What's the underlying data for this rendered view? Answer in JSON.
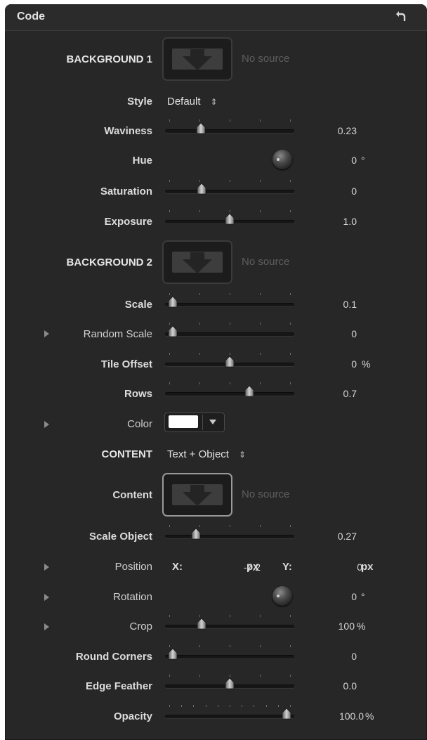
{
  "panel": {
    "title": "Code"
  },
  "background1": {
    "section_label": "BACKGROUND 1",
    "well_text": "No source"
  },
  "style": {
    "label": "Style",
    "value": "Default"
  },
  "waviness": {
    "label": "Waviness",
    "value": "0.23",
    "fraction": 0.26
  },
  "hue": {
    "label": "Hue",
    "value": "0",
    "unit": "°"
  },
  "saturation": {
    "label": "Saturation",
    "value": "0",
    "fraction": 0.27
  },
  "exposure": {
    "label": "Exposure",
    "value": "1.0",
    "fraction": 0.5
  },
  "background2": {
    "section_label": "BACKGROUND 2",
    "well_text": "No source"
  },
  "scale": {
    "label": "Scale",
    "value": "0.1",
    "fraction": 0.03
  },
  "random_scale": {
    "label": "Random Scale",
    "value": "0",
    "fraction": 0.03
  },
  "tile_offset": {
    "label": "Tile Offset",
    "value": "0",
    "unit": "%",
    "fraction": 0.5
  },
  "rows": {
    "label": "Rows",
    "value": "0.7",
    "fraction": 0.66
  },
  "color": {
    "label": "Color",
    "swatch": "#ffffff"
  },
  "content_mode": {
    "label": "CONTENT",
    "value": "Text + Object"
  },
  "content": {
    "label": "Content",
    "well_text": "No source"
  },
  "scale_object": {
    "label": "Scale Object",
    "value": "0.27",
    "fraction": 0.22
  },
  "position": {
    "label": "Position",
    "x_label": "X:",
    "x_value": "-7.2",
    "x_unit": "px",
    "y_label": "Y:",
    "y_value": "0",
    "y_unit": "px"
  },
  "rotation": {
    "label": "Rotation",
    "value": "0",
    "unit": "°"
  },
  "crop": {
    "label": "Crop",
    "value": "100",
    "unit": "%",
    "fraction": 0.27
  },
  "round_corners": {
    "label": "Round Corners",
    "value": "0",
    "fraction": 0.03
  },
  "edge_feather": {
    "label": "Edge Feather",
    "value": "0.0",
    "fraction": 0.5
  },
  "opacity": {
    "label": "Opacity",
    "value": "100.0",
    "unit": "%",
    "fraction": 0.97
  },
  "colors": {
    "panel_bg": "#272727",
    "text": "#dcdcdc",
    "dim": "#5e5e5e"
  }
}
